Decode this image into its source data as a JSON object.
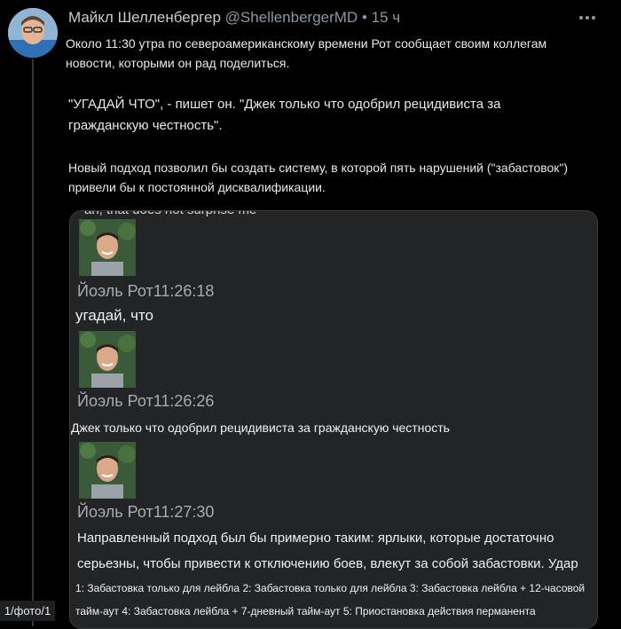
{
  "author": {
    "name": "Майкл Шелленбергер",
    "handle": "@ShellenbergerMD",
    "separator": "•",
    "time": "15 ч"
  },
  "tweet": {
    "paragraph1": "Около 11:30 утра по североамериканскому времени Рот сообщает своим коллегам новости, которыми он рад поделиться.",
    "paragraph2": "\"УГАДАЙ ЧТО\", - пишет он. \"Джек только что одобрил рецидивиста за гражданскую честность\".",
    "paragraph3": "Новый подход позволил бы создать систему, в которой пять нарушений (\"забастовок\") привели бы к постоянной дисквалификации."
  },
  "card": {
    "cut_text": "ah, that does not surprise me",
    "messages": [
      {
        "sender": "Йоэль Рот11:26:18",
        "text": "угадай, что"
      },
      {
        "sender": "Йоэль Рот11:26:26",
        "text": "Джек только что одобрил рецидивиста за гражданскую честность"
      },
      {
        "sender": "Йоэль Рот11:27:30",
        "text": "Направленный подход был бы примерно таким: ярлыки, которые достаточно",
        "text2": "серьезны, чтобы привести к отключению боев, влекут за собой забастовки. Удар",
        "text3": "1: Забастовка только для лейбла 2: Забастовка только для лейбла 3: Забастовка лейбла + 12-часовой",
        "text4": "тайм-аут 4: Забастовка лейбла + 7-дневный тайм-аут 5: Приостановка действия перманента"
      }
    ]
  },
  "photo_counter": "1/фото/1",
  "colors": {
    "background": "#000000",
    "card": "#222426",
    "muted": "#8b98a5"
  }
}
